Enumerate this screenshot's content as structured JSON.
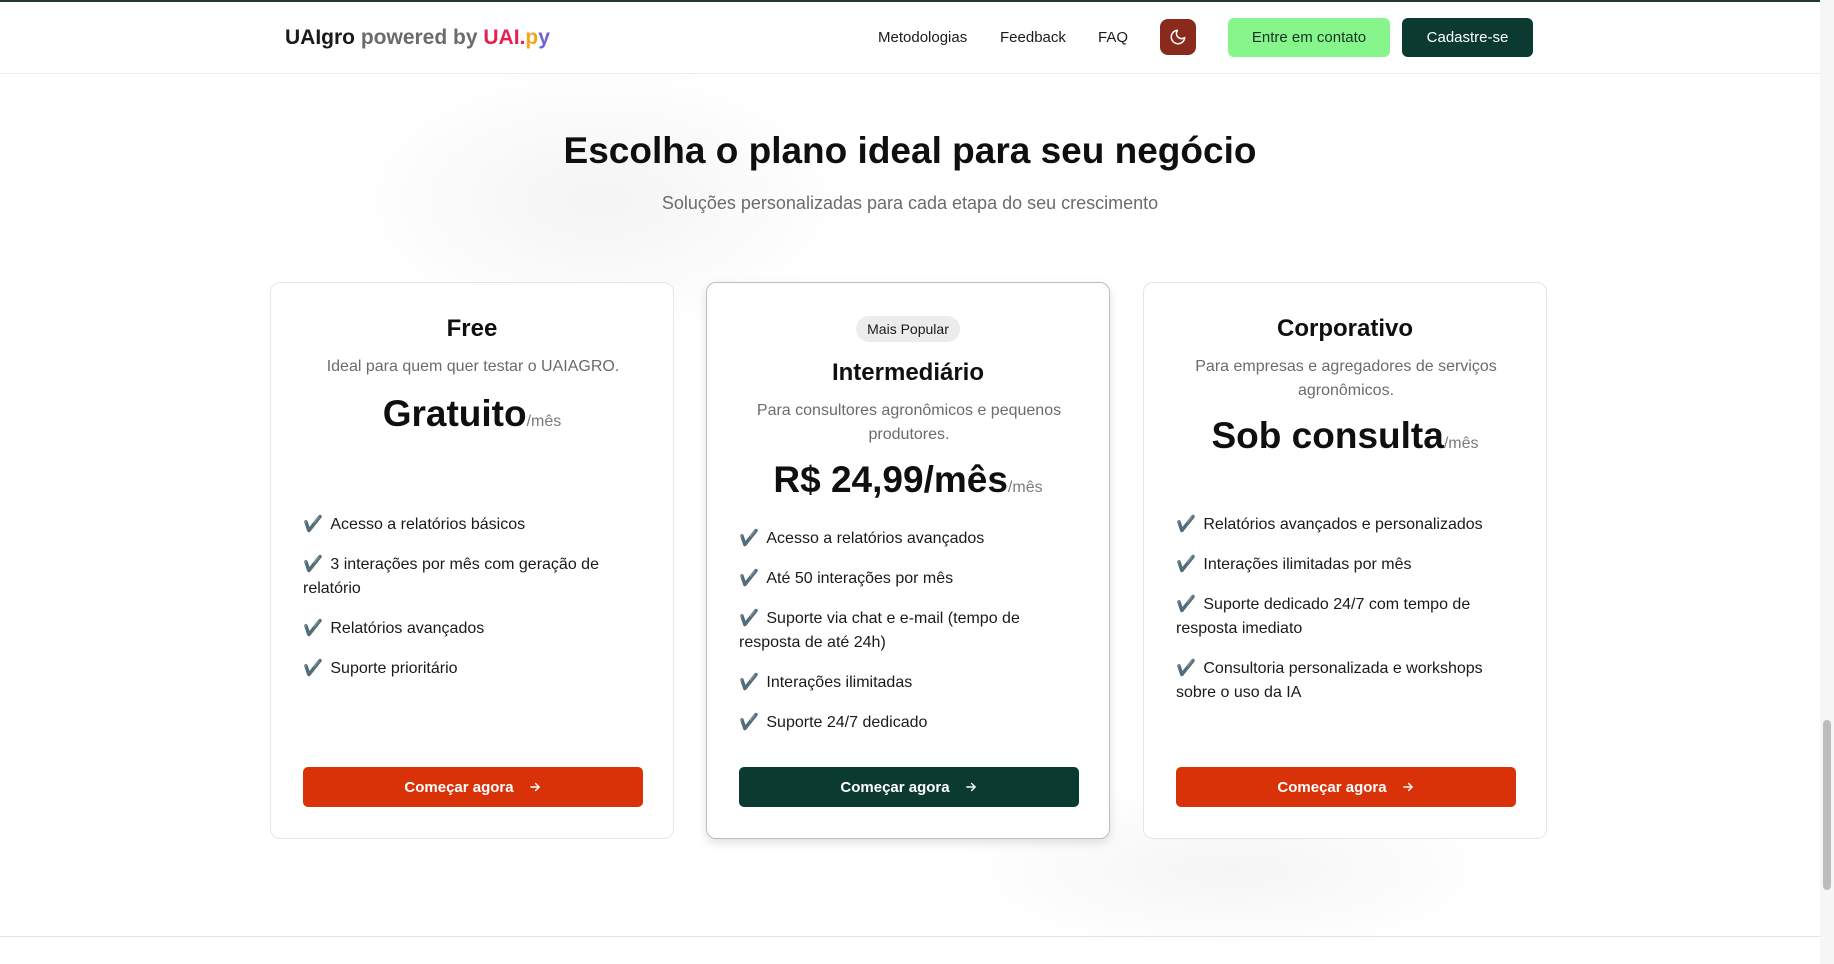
{
  "header": {
    "brand": {
      "name": "UAIgro",
      "powered": "powered by",
      "uai": "UAI",
      "dot": ".",
      "p": "p",
      "y": "y"
    },
    "nav": [
      "Metodologias",
      "Feedback",
      "FAQ"
    ],
    "theme_icon": "moon-icon",
    "contact_label": "Entre em contato",
    "signup_label": "Cadastre-se"
  },
  "hero": {
    "title": "Escolha o plano ideal para seu negócio",
    "subtitle": "Soluções personalizadas para cada etapa do seu crescimento"
  },
  "plans": [
    {
      "name": "Free",
      "description": "Ideal para quem quer testar o UAIAGRO.",
      "price": "Gratuito",
      "period": "/mês",
      "features": [
        "Acesso a relatórios básicos",
        "3 interações por mês com geração de relatório",
        "Relatórios avançados",
        "Suporte prioritário"
      ],
      "cta": "Começar agora"
    },
    {
      "badge": "Mais Popular",
      "name": "Intermediário",
      "description": "Para consultores agronômicos e pequenos produtores.",
      "price": "R$ 24,99/mês",
      "period": "/mês",
      "features": [
        "Acesso a relatórios avançados",
        "Até 50 interações por mês",
        "Suporte via chat e e-mail (tempo de resposta de até 24h)",
        "Interações ilimitadas",
        "Suporte 24/7 dedicado"
      ],
      "cta": "Começar agora"
    },
    {
      "name": "Corporativo",
      "description": "Para empresas e agregadores de serviços agronômicos.",
      "price": "Sob consulta",
      "period": "/mês",
      "features": [
        "Relatórios avançados e personalizados",
        "Interações ilimitadas por mês",
        "Suporte dedicado 24/7 com tempo de resposta imediato",
        "Consultoria personalizada e workshops sobre o uso da IA"
      ],
      "cta": "Começar agora"
    }
  ],
  "check_glyph": "✔️",
  "colors": {
    "brand_dark": "#0b3b30",
    "accent_orange": "#d93209",
    "contact_green": "#86f58c",
    "theme_button": "#8a2a1c"
  }
}
